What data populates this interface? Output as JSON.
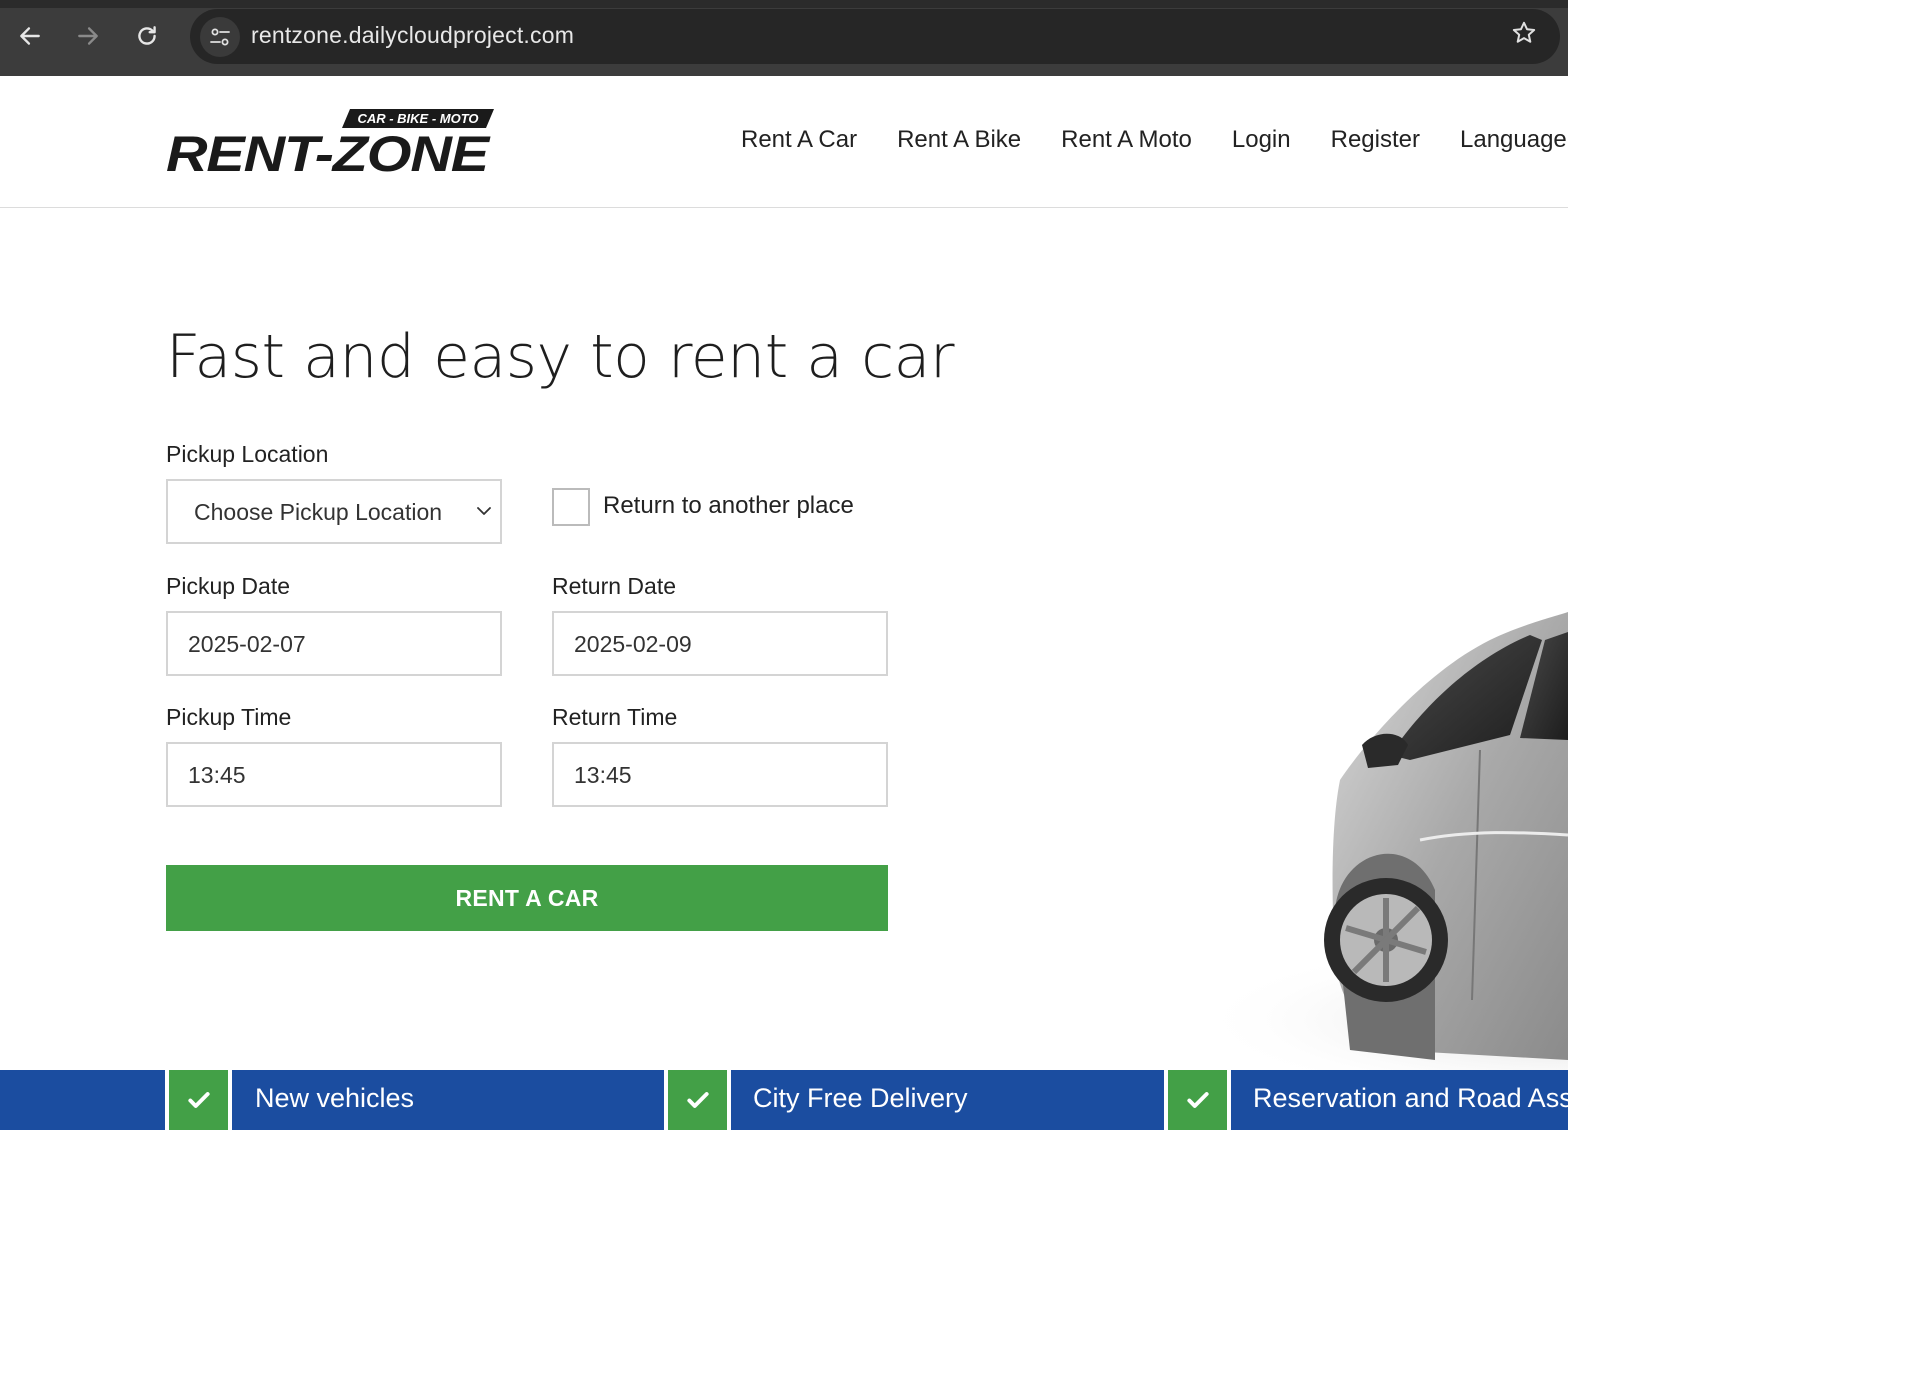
{
  "browser": {
    "url": "rentzone.dailycloudproject.com"
  },
  "logo": {
    "top_text": "CAR - BIKE - MOTO",
    "main_text": "RENT-ZONE"
  },
  "nav": {
    "items": [
      "Rent A Car",
      "Rent A Bike",
      "Rent A Moto",
      "Login",
      "Register",
      "Language"
    ]
  },
  "hero": {
    "title": "Fast and easy to rent a car"
  },
  "form": {
    "pickup_location_label": "Pickup Location",
    "pickup_location_value": "Choose Pickup Location",
    "return_other_label": "Return to another place",
    "return_other_checked": false,
    "pickup_date_label": "Pickup Date",
    "pickup_date_value": "2025-02-07",
    "return_date_label": "Return Date",
    "return_date_value": "2025-02-09",
    "pickup_time_label": "Pickup Time",
    "pickup_time_value": "13:45",
    "return_time_label": "Return Time",
    "return_time_value": "13:45",
    "submit_label": "RENT A CAR"
  },
  "features": [
    {
      "label": "New vehicles"
    },
    {
      "label": "City Free Delivery"
    },
    {
      "label": "Reservation and Road Assis"
    }
  ],
  "colors": {
    "accent_green": "#43a047",
    "feature_blue": "#1b4da0"
  }
}
